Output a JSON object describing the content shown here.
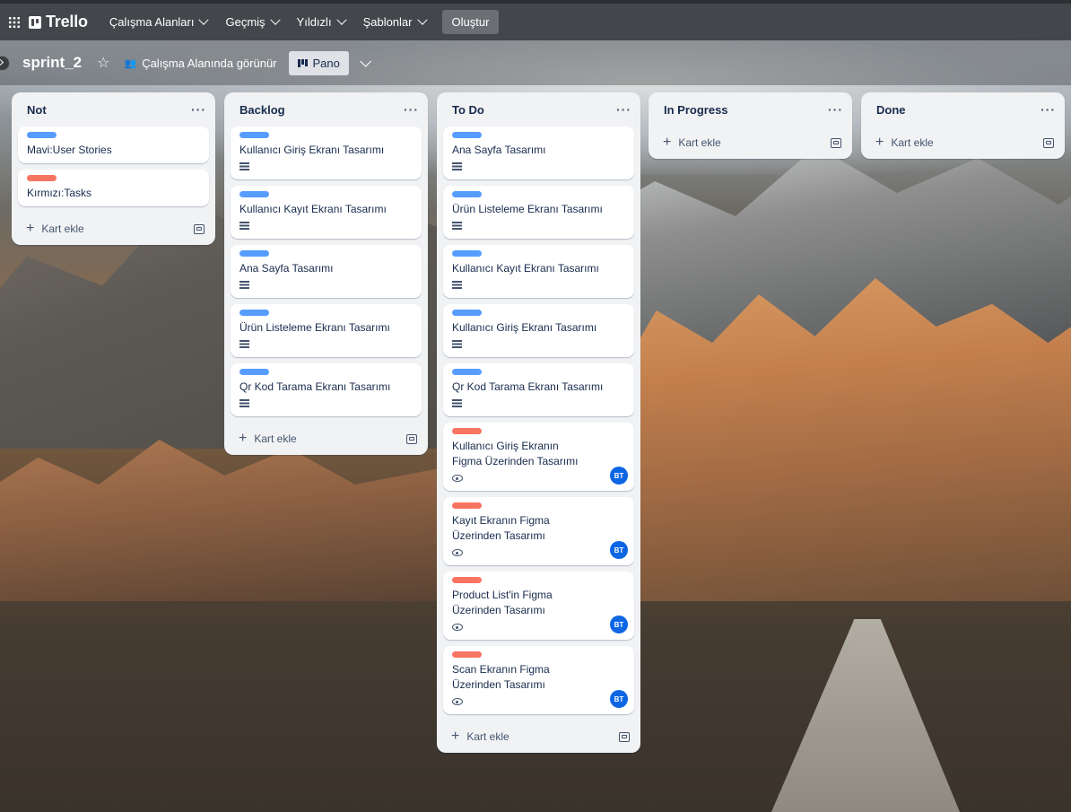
{
  "nav": {
    "brand": "Trello",
    "menus": [
      "Çalışma Alanları",
      "Geçmiş",
      "Yıldızlı",
      "Şablonlar"
    ],
    "create_label": "Oluştur"
  },
  "board": {
    "name": "sprint_2",
    "visibility": "Çalışma Alanında görünür",
    "view": "Pano"
  },
  "add_card_label": "Kart ekle",
  "avatar_initials": "BT",
  "colors": {
    "blue_label": "#579dff",
    "red_label": "#f87462",
    "avatar": "#0c66e4"
  },
  "lists": [
    {
      "title": "Not",
      "cards": [
        {
          "label": "blue",
          "title": "Mavi:User Stories",
          "icon": "none"
        },
        {
          "label": "red",
          "title": "Kırmızı:Tasks",
          "icon": "none"
        }
      ]
    },
    {
      "title": "Backlog",
      "cards": [
        {
          "label": "blue",
          "title": "Kullanıcı Giriş Ekranı Tasarımı",
          "icon": "description"
        },
        {
          "label": "blue",
          "title": "Kullanıcı Kayıt Ekranı Tasarımı",
          "icon": "description"
        },
        {
          "label": "blue",
          "title": "Ana Sayfa Tasarımı",
          "icon": "description"
        },
        {
          "label": "blue",
          "title": "Ürün Listeleme Ekranı Tasarımı",
          "icon": "description"
        },
        {
          "label": "blue",
          "title": "Qr Kod Tarama Ekranı Tasarımı",
          "icon": "description"
        }
      ]
    },
    {
      "title": "To Do",
      "cards": [
        {
          "label": "blue",
          "title": "Ana Sayfa Tasarımı",
          "icon": "description"
        },
        {
          "label": "blue",
          "title": "Ürün Listeleme Ekranı Tasarımı",
          "icon": "description"
        },
        {
          "label": "blue",
          "title": "Kullanıcı Kayıt Ekranı Tasarımı",
          "icon": "description"
        },
        {
          "label": "blue",
          "title": "Kullanıcı Giriş Ekranı Tasarımı",
          "icon": "description"
        },
        {
          "label": "blue",
          "title": "Qr Kod Tarama Ekranı Tasarımı",
          "icon": "description"
        },
        {
          "label": "red",
          "title": "Kullanıcı Giriş Ekranın Figma Üzerinden Tasarımı",
          "icon": "watch",
          "member": "BT"
        },
        {
          "label": "red",
          "title": "Kayıt Ekranın Figma Üzerinden Tasarımı",
          "icon": "watch",
          "member": "BT"
        },
        {
          "label": "red",
          "title": "Product List'in Figma Üzerinden Tasarımı",
          "icon": "watch",
          "member": "BT"
        },
        {
          "label": "red",
          "title": "Scan Ekranın Figma Üzerinden Tasarımı",
          "icon": "watch",
          "member": "BT"
        }
      ]
    },
    {
      "title": "In Progress",
      "cards": []
    },
    {
      "title": "Done",
      "cards": []
    }
  ]
}
